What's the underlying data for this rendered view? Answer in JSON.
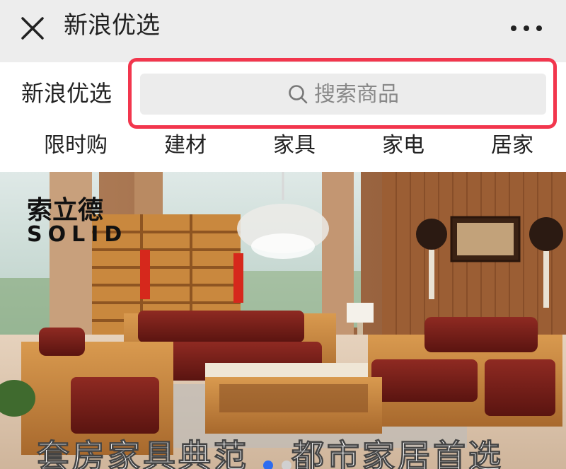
{
  "titlebar": {
    "title": "新浪优选",
    "close_icon": "close-icon",
    "more_icon": "more-icon"
  },
  "header": {
    "brand": "新浪优选",
    "search": {
      "placeholder": "搜索商品",
      "icon": "search-icon"
    }
  },
  "tabs": [
    {
      "label": "限时购"
    },
    {
      "label": "建材"
    },
    {
      "label": "家具"
    },
    {
      "label": "家电"
    },
    {
      "label": "居家"
    }
  ],
  "banner": {
    "logo_cn": "索立德",
    "logo_en": "SOLID",
    "slogan": "套房家具典范   都市家居首选",
    "active_slide": 1
  },
  "colors": {
    "highlight": "#f2364d",
    "titlebar_bg": "#ededed",
    "search_bg": "#ececec",
    "active_dot": "#2d6cf0"
  }
}
